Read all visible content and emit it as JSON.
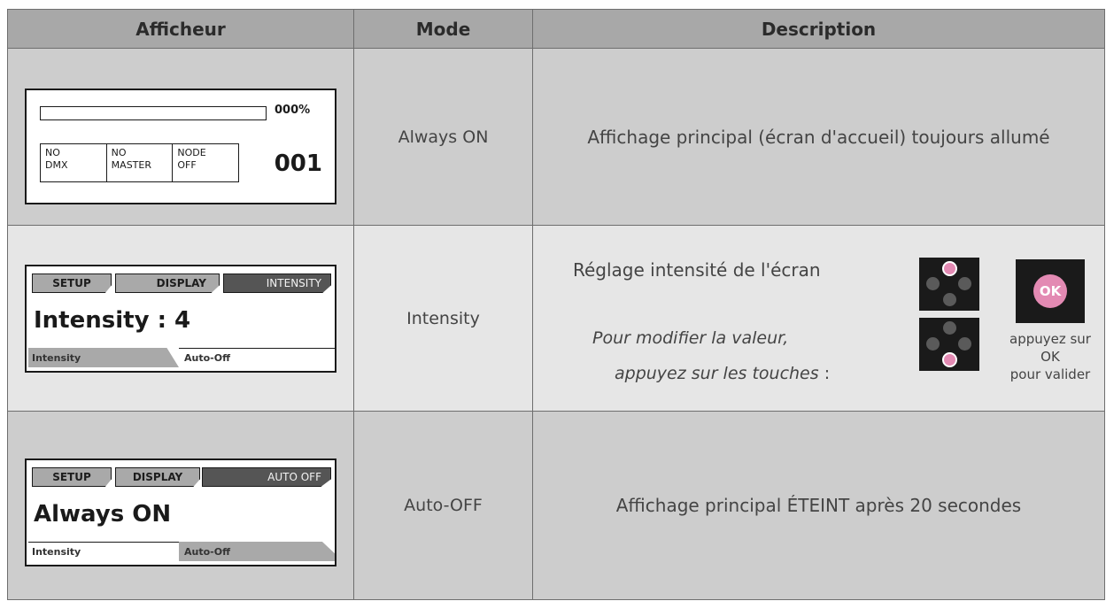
{
  "headers": {
    "col1": "Afficheur",
    "col2": "Mode",
    "col3": "Description"
  },
  "rows": [
    {
      "screen": {
        "percent": "000%",
        "boxes": [
          {
            "l1": "NO",
            "l2": "DMX"
          },
          {
            "l1": "NO",
            "l2": "MASTER"
          },
          {
            "l1": "NODE",
            "l2": "OFF"
          }
        ],
        "number": "001"
      },
      "mode": "Always ON",
      "description": "Affichage principal (écran d'accueil) toujours allumé"
    },
    {
      "screen": {
        "tabs": [
          "SETUP",
          "DISPLAY",
          "INTENSITY"
        ],
        "value": "Intensity : 4",
        "sub_left": "Intensity",
        "sub_right": "Auto-Off"
      },
      "mode": "Intensity",
      "description_title": "Réglage intensité de l'écran",
      "instruction_line1": "Pour modifier la valeur,",
      "instruction_line2": "appuyez sur les touches",
      "instruction_colon": " :",
      "ok_label": "OK",
      "ok_line1": "appuyez sur",
      "ok_line2": "OK",
      "ok_line3": "pour valider"
    },
    {
      "screen": {
        "tabs": [
          "SETUP",
          "DISPLAY",
          "AUTO OFF"
        ],
        "value": "Always ON",
        "sub_left": "Intensity",
        "sub_right": "Auto-Off"
      },
      "mode": "Auto-OFF",
      "description": "Affichage principal ÉTEINT après 20 secondes"
    }
  ],
  "colors": {
    "header": "#a8a8a8",
    "row_grey": "#cdcdcd",
    "row_light": "#e6e6e6",
    "ok_button": "#e38ab3",
    "key_active": "#e38ab3"
  },
  "icons": [
    "arrow-keypad-up-icon",
    "arrow-keypad-down-icon",
    "ok-button-icon"
  ]
}
